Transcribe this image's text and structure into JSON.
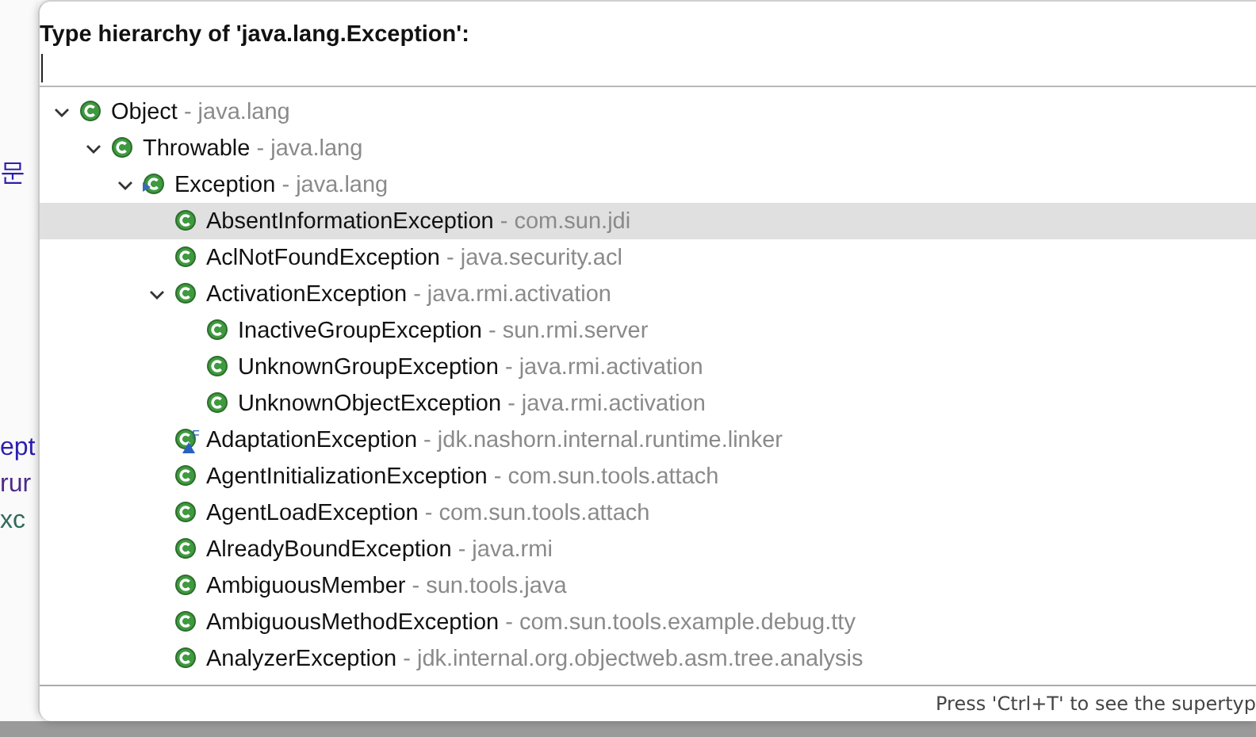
{
  "editor_fragments": [
    "문",
    "ept",
    "rur",
    "xc"
  ],
  "popup": {
    "title": "Type hierarchy of 'java.lang.Exception':",
    "tree": [
      {
        "name": "Object",
        "package": "- java.lang",
        "expanded": true,
        "selected": false,
        "children": [
          {
            "name": "Throwable",
            "package": "- java.lang",
            "expanded": true,
            "selected": false,
            "children": [
              {
                "name": "Exception",
                "package": "- java.lang",
                "expanded": true,
                "selected": false,
                "overlay": {
                  "kind": "focus"
                },
                "children": [
                  {
                    "name": "AbsentInformationException",
                    "package": "- com.sun.jdi",
                    "selected": true
                  },
                  {
                    "name": "AclNotFoundException",
                    "package": "- java.security.acl",
                    "selected": false
                  },
                  {
                    "name": "ActivationException",
                    "package": "- java.rmi.activation",
                    "expanded": true,
                    "selected": false,
                    "children": [
                      {
                        "name": "InactiveGroupException",
                        "package": "- sun.rmi.server",
                        "selected": false
                      },
                      {
                        "name": "UnknownGroupException",
                        "package": "- java.rmi.activation",
                        "selected": false
                      },
                      {
                        "name": "UnknownObjectException",
                        "package": "- java.rmi.activation",
                        "selected": false
                      }
                    ]
                  },
                  {
                    "name": "AdaptationException",
                    "package": "- jdk.nashorn.internal.runtime.linker",
                    "selected": false,
                    "overlay": {
                      "kind": "final",
                      "letter": "F"
                    }
                  },
                  {
                    "name": "AgentInitializationException",
                    "package": "- com.sun.tools.attach",
                    "selected": false
                  },
                  {
                    "name": "AgentLoadException",
                    "package": "- com.sun.tools.attach",
                    "selected": false
                  },
                  {
                    "name": "AlreadyBoundException",
                    "package": "- java.rmi",
                    "selected": false
                  },
                  {
                    "name": "AmbiguousMember",
                    "package": "- sun.tools.java",
                    "selected": false
                  },
                  {
                    "name": "AmbiguousMethodException",
                    "package": "- com.sun.tools.example.debug.tty",
                    "selected": false
                  },
                  {
                    "name": "AnalyzerException",
                    "package": "- jdk.internal.org.objectweb.asm.tree.analysis",
                    "selected": false
                  }
                ]
              }
            ]
          }
        ]
      }
    ],
    "status": "Press 'Ctrl+T' to see the supertyp"
  }
}
